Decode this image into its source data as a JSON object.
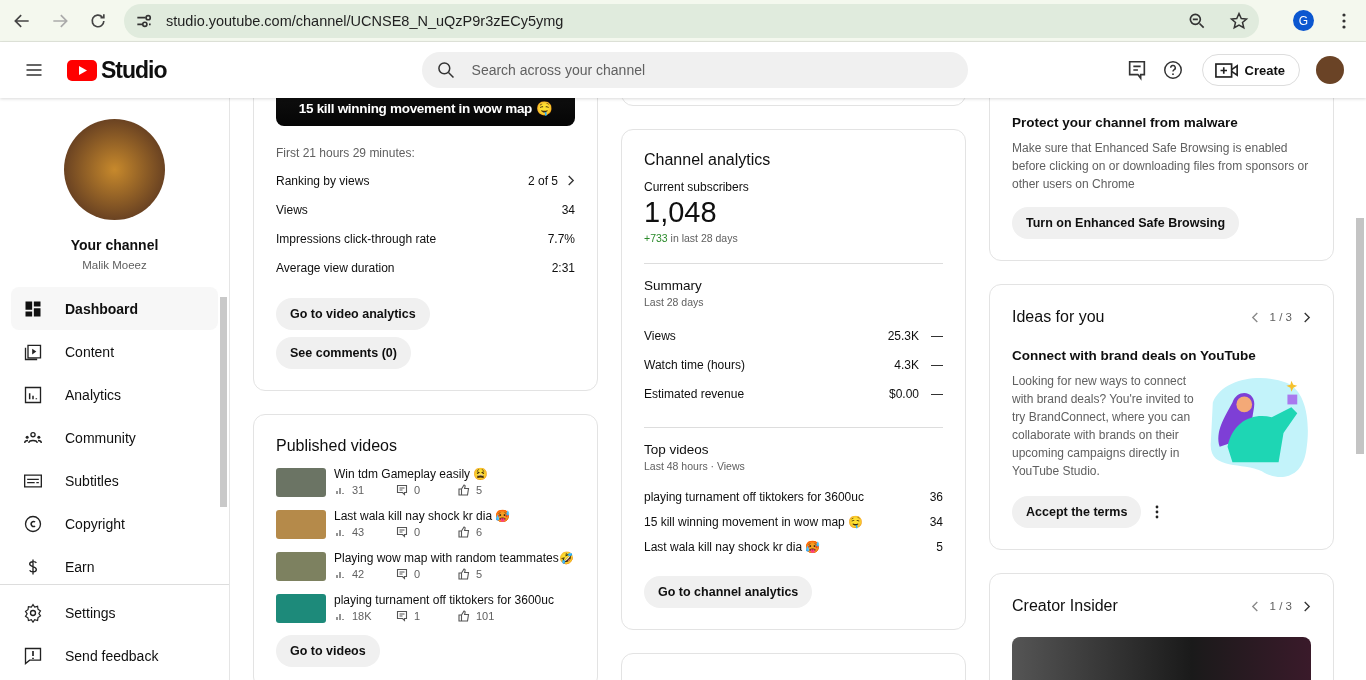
{
  "browser": {
    "url": "studio.youtube.com/channel/UCNSE8_N_uQzP9r3zECy5ymg",
    "profile_initial": "G"
  },
  "header": {
    "logo_text": "Studio",
    "search_placeholder": "Search across your channel",
    "create_label": "Create"
  },
  "sidebar": {
    "channel_title": "Your channel",
    "channel_name": "Malik Moeez",
    "nav": [
      {
        "label": "Dashboard",
        "selected": true
      },
      {
        "label": "Content",
        "selected": false
      },
      {
        "label": "Analytics",
        "selected": false
      },
      {
        "label": "Community",
        "selected": false
      },
      {
        "label": "Subtitles",
        "selected": false
      },
      {
        "label": "Copyright",
        "selected": false
      },
      {
        "label": "Earn",
        "selected": false
      }
    ],
    "footer": [
      {
        "label": "Settings"
      },
      {
        "label": "Send feedback"
      }
    ]
  },
  "latest_video": {
    "title_overlay": "15 kill winning movement in wow map 🤤",
    "period": "First 21 hours 29 minutes:",
    "stats": [
      {
        "label": "Ranking by views",
        "value": "2 of 5",
        "link": true
      },
      {
        "label": "Views",
        "value": "34",
        "link": false
      },
      {
        "label": "Impressions click-through rate",
        "value": "7.7%",
        "link": false
      },
      {
        "label": "Average view duration",
        "value": "2:31",
        "link": false
      }
    ],
    "buttons": [
      "Go to video analytics",
      "See comments (0)"
    ]
  },
  "published": {
    "title": "Published videos",
    "videos": [
      {
        "title": "Win tdm Gameplay easily 😫",
        "views": "31",
        "comments": "0",
        "likes": "5"
      },
      {
        "title": "Last wala kill nay shock kr dia 🥵",
        "views": "43",
        "comments": "0",
        "likes": "6"
      },
      {
        "title": "Playing wow map with random teammates🤣",
        "views": "42",
        "comments": "0",
        "likes": "5"
      },
      {
        "title": "playing turnament off tiktokers for 3600uc",
        "views": "18K",
        "comments": "1",
        "likes": "101"
      }
    ],
    "button": "Go to videos"
  },
  "analytics": {
    "title": "Channel analytics",
    "subscribers_label": "Current subscribers",
    "subscribers": "1,048",
    "change": "+733",
    "change_suffix": "in last 28 days",
    "summary_title": "Summary",
    "summary_period": "Last 28 days",
    "summary": [
      {
        "label": "Views",
        "value": "25.3K",
        "trend": "—"
      },
      {
        "label": "Watch time (hours)",
        "value": "4.3K",
        "trend": "—"
      },
      {
        "label": "Estimated revenue",
        "value": "$0.00",
        "trend": "—"
      }
    ],
    "top_title": "Top videos",
    "top_period": "Last 48 hours · Views",
    "top": [
      {
        "title": "playing turnament off tiktokers for 3600uc",
        "views": "36"
      },
      {
        "title": "15 kill winning movement in wow map 🤤",
        "views": "34"
      },
      {
        "title": "Last wala kill nay shock kr dia 🥵",
        "views": "5"
      }
    ],
    "button": "Go to channel analytics"
  },
  "malware": {
    "title": "Protect your channel from malware",
    "body": "Make sure that Enhanced Safe Browsing is enabled before clicking on or downloading files from sponsors or other users on Chrome",
    "button": "Turn on Enhanced Safe Browsing"
  },
  "ideas": {
    "title": "Ideas for you",
    "pager": "1 / 3",
    "subtitle": "Connect with brand deals on YouTube",
    "body": "Looking for new ways to connect with brand deals? You're invited to try BrandConnect, where you can collaborate with brands on their upcoming campaigns directly in YouTube Studio.",
    "button": "Accept the terms"
  },
  "insider": {
    "title": "Creator Insider",
    "pager": "1 / 3"
  }
}
